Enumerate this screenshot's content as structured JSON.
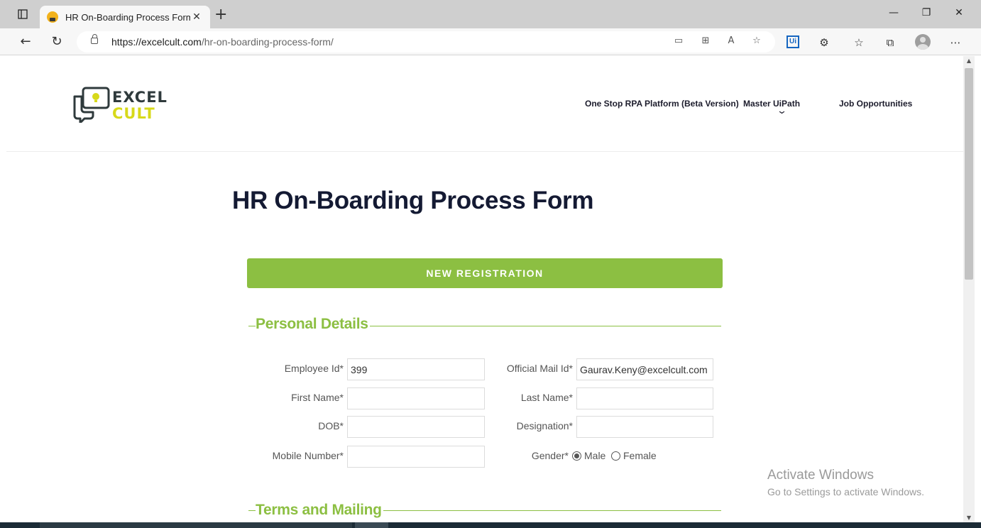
{
  "browser": {
    "tab_title": "HR On-Boarding Process Form –",
    "tab_close": "✕",
    "new_tab": "+",
    "controls": {
      "minimize": "—",
      "restore": "❐",
      "close": "✕"
    },
    "nav": {
      "back": "←",
      "refresh": "↻"
    },
    "url_host": "https://excelcult.com",
    "url_path": "/hr-on-boarding-process-form/",
    "address_icons": [
      "▭",
      "⊞",
      "A",
      "☆"
    ],
    "toolbar_icons": {
      "ui_ext": "Ui",
      "extensions": "⚙",
      "favorites": "☆",
      "collections": "⧉",
      "more": "⋯"
    }
  },
  "site": {
    "logo_line1": "EXCEL",
    "logo_line2": "CULT",
    "nav": {
      "item1": "One Stop RPA Platform (Beta Version)",
      "item2": "Master UiPath",
      "item3": "Job Opportunities",
      "dropdown": "⌄"
    }
  },
  "page": {
    "title": "HR On-Boarding Process Form",
    "registration_button": "NEW REGISTRATION",
    "section_personal": "Personal Details",
    "section_terms": "Terms and Mailing"
  },
  "form": {
    "employee_id": {
      "label": "Employee Id*",
      "value": "399"
    },
    "official_mail": {
      "label": "Official Mail Id*",
      "value": "Gaurav.Keny@excelcult.com"
    },
    "first_name": {
      "label": "First Name*",
      "value": ""
    },
    "last_name": {
      "label": "Last Name*",
      "value": ""
    },
    "dob": {
      "label": "DOB*",
      "value": ""
    },
    "designation": {
      "label": "Designation*",
      "value": ""
    },
    "mobile": {
      "label": "Mobile Number*",
      "value": ""
    },
    "gender": {
      "label": "Gender*",
      "options": [
        "Male",
        "Female"
      ],
      "selected": "Male"
    }
  },
  "watermark": {
    "line1": "Activate Windows",
    "line2": "Go to Settings to activate Windows."
  },
  "colors": {
    "accent_green": "#8cbf42",
    "title_navy": "#141a33",
    "logo_dark": "#2f3a3c",
    "logo_yellow": "#d7d91a"
  }
}
